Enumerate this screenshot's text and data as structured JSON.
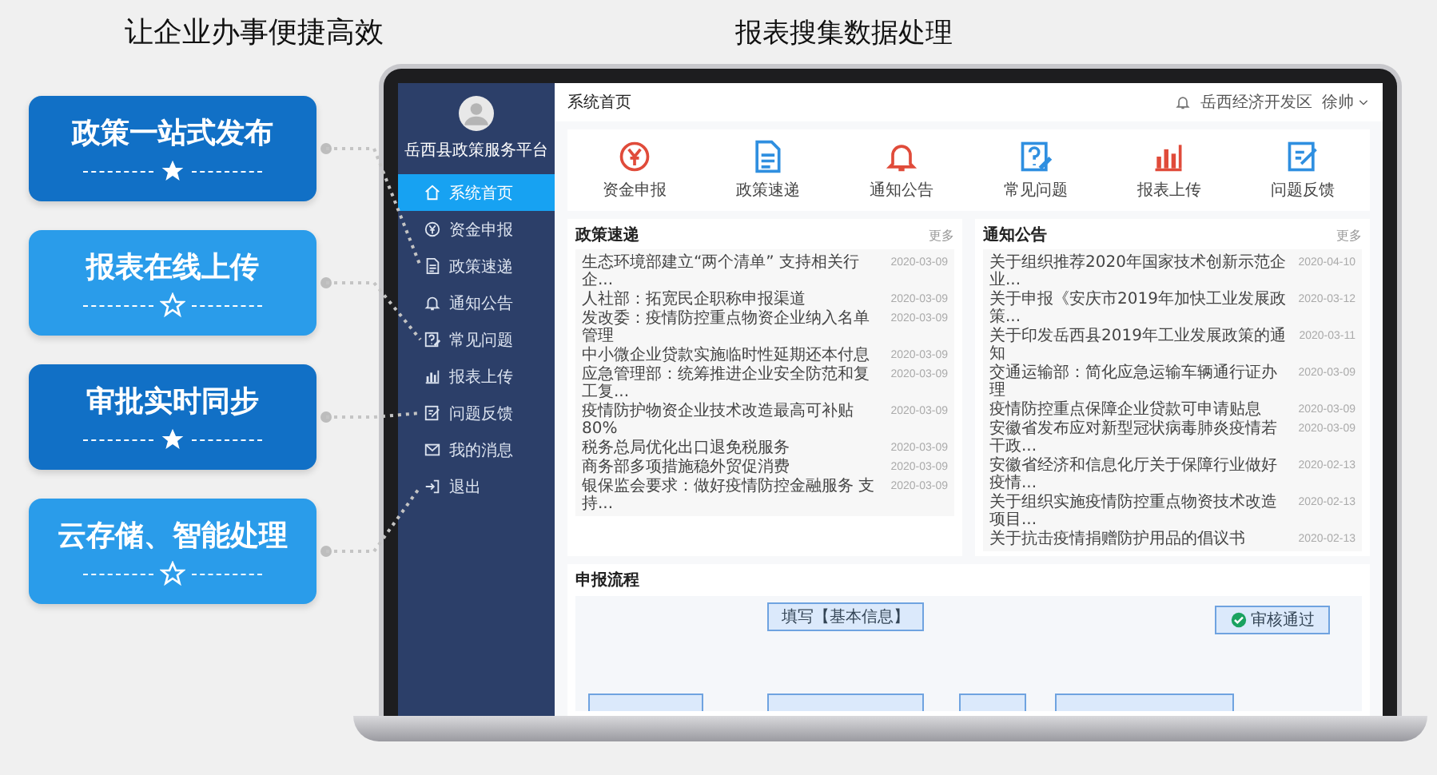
{
  "headings": {
    "left": "让企业办事便捷高效",
    "right": "报表搜集数据处理"
  },
  "features": [
    {
      "title": "政策一站式发布",
      "star_filled": true,
      "color": "#1170c6"
    },
    {
      "title": "报表在线上传",
      "star_filled": false,
      "color": "#2a9cea"
    },
    {
      "title": "审批实时同步",
      "star_filled": true,
      "color": "#1170c6"
    },
    {
      "title": "云存储、智能处理",
      "star_filled": false,
      "color": "#2a9cea"
    }
  ],
  "app": {
    "sidebar": {
      "platform_name": "岳西县政策服务平台",
      "items": [
        {
          "label": "系统首页",
          "kind": "home",
          "selected": true
        },
        {
          "label": "资金申报",
          "kind": "coin",
          "selected": false
        },
        {
          "label": "政策速递",
          "kind": "doc",
          "selected": false
        },
        {
          "label": "通知公告",
          "kind": "bell",
          "selected": false
        },
        {
          "label": "常见问题",
          "kind": "question",
          "selected": false
        },
        {
          "label": "报表上传",
          "kind": "chart",
          "selected": false
        },
        {
          "label": "问题反馈",
          "kind": "edit",
          "selected": false
        },
        {
          "label": "我的消息",
          "kind": "mail",
          "selected": false
        },
        {
          "label": "退出",
          "kind": "exit",
          "selected": false
        }
      ]
    },
    "header": {
      "title": "系统首页",
      "org": "岳西经济开发区",
      "user": "徐帅"
    },
    "shortcuts": [
      {
        "label": "资金申报",
        "kind": "coin",
        "color": "#e04b3a"
      },
      {
        "label": "政策速递",
        "kind": "doc",
        "color": "#2f8fe0"
      },
      {
        "label": "通知公告",
        "kind": "bell",
        "color": "#e04b3a"
      },
      {
        "label": "常见问题",
        "kind": "question",
        "color": "#2f8fe0"
      },
      {
        "label": "报表上传",
        "kind": "chart",
        "color": "#e04b3a"
      },
      {
        "label": "问题反馈",
        "kind": "edit",
        "color": "#2f8fe0"
      }
    ],
    "panels": [
      {
        "title": "政策速递",
        "more": "更多",
        "items": [
          {
            "text": "生态环境部建立“两个清单” 支持相关行企...",
            "date": "2020-03-09"
          },
          {
            "text": "人社部：拓宽民企职称申报渠道",
            "date": "2020-03-09"
          },
          {
            "text": "发改委：疫情防控重点物资企业纳入名单管理",
            "date": "2020-03-09"
          },
          {
            "text": "中小微企业贷款实施临时性延期还本付息",
            "date": "2020-03-09"
          },
          {
            "text": "应急管理部：统筹推进企业安全防范和复工复...",
            "date": "2020-03-09"
          },
          {
            "text": "疫情防护物资企业技术改造最高可补贴80%",
            "date": "2020-03-09"
          },
          {
            "text": "税务总局优化出口退免税服务",
            "date": "2020-03-09"
          },
          {
            "text": "商务部多项措施稳外贸促消费",
            "date": "2020-03-09"
          },
          {
            "text": "银保监会要求：做好疫情防控金融服务 支持...",
            "date": "2020-03-09"
          }
        ]
      },
      {
        "title": "通知公告",
        "more": "更多",
        "items": [
          {
            "text": "关于组织推荐2020年国家技术创新示范企业...",
            "date": "2020-04-10"
          },
          {
            "text": "关于申报《安庆市2019年加快工业发展政策...",
            "date": "2020-03-12"
          },
          {
            "text": "关于印发岳西县2019年工业发展政策的通知",
            "date": "2020-03-11"
          },
          {
            "text": "交通运输部：简化应急运输车辆通行证办理",
            "date": "2020-03-09"
          },
          {
            "text": "疫情防控重点保障企业贷款可申请贴息",
            "date": "2020-03-09"
          },
          {
            "text": "安徽省发布应对新型冠状病毒肺炎疫情若干政...",
            "date": "2020-03-09"
          },
          {
            "text": "安徽省经济和信息化厅关于保障行业做好疫情...",
            "date": "2020-02-13"
          },
          {
            "text": "关于组织实施疫情防控重点物资技术改造项目...",
            "date": "2020-02-13"
          },
          {
            "text": "关于抗击疫情捐赠防护用品的倡议书",
            "date": "2020-02-13"
          }
        ]
      }
    ],
    "process": {
      "title": "申报流程",
      "steps": [
        "填写【基本信息】",
        "审核通过"
      ]
    }
  }
}
